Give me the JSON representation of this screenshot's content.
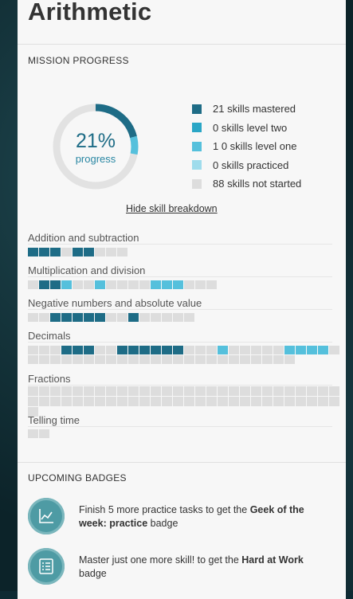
{
  "title": "Arithmetic",
  "mission_progress": {
    "header": "MISSION PROGRESS",
    "percent_value": 21,
    "percent": "21%",
    "percent_label": "progress",
    "legend": [
      {
        "text": "21  skills mastered",
        "color": "#1e6c86"
      },
      {
        "text": "0  skills level two",
        "color": "#2aa6c6"
      },
      {
        "text": "1 0  skills level one",
        "color": "#55c0dc"
      },
      {
        "text": "0  skills practiced",
        "color": "#9fdcec"
      },
      {
        "text": "88  skills not started",
        "color": "#dddddd"
      }
    ],
    "toggle": "Hide skill breakdown"
  },
  "colors": {
    "mastered": "#1e6c86",
    "level_two": "#2aa6c6",
    "level_one": "#55c0dc",
    "practiced": "#9fdcec",
    "not_started": "#dddddd",
    "ring_track": "#e2e2e2"
  },
  "skills": [
    {
      "name": "Addition and subtraction",
      "cells": "MMMNMMNNN"
    },
    {
      "name": "Multiplication and division",
      "cells": "NMMLNNLNNNNLLLNNN"
    },
    {
      "name": "Negative numbers and absolute value",
      "cells": "NNMMMMMNNMNNNNN"
    },
    {
      "name": "Decimals",
      "cells": "NNNMMMNNMMMMMMNNNLNNNNNLLLLNNNNNNNNNNNNNNNNNNNNNNNNN"
    },
    {
      "name": "Fractions",
      "cells": "NNNNNNNNNNNNNNNNNNNNNNNNNNNNNNNNNNNNNNNNNNNNNNNNNNNNNNNNN"
    },
    {
      "name": "Telling time",
      "cells": "NN"
    }
  ],
  "upcoming_badges": {
    "header": "UPCOMING BADGES",
    "items": [
      {
        "icon": "chart-icon",
        "pre": "Finish 5 more practice tasks to get the ",
        "bold": "Geek of the week: practice",
        "post": " badge"
      },
      {
        "icon": "checklist-icon",
        "pre": "Master just one more skill! to get the ",
        "bold": "Hard at Work",
        "post": " badge"
      }
    ]
  }
}
